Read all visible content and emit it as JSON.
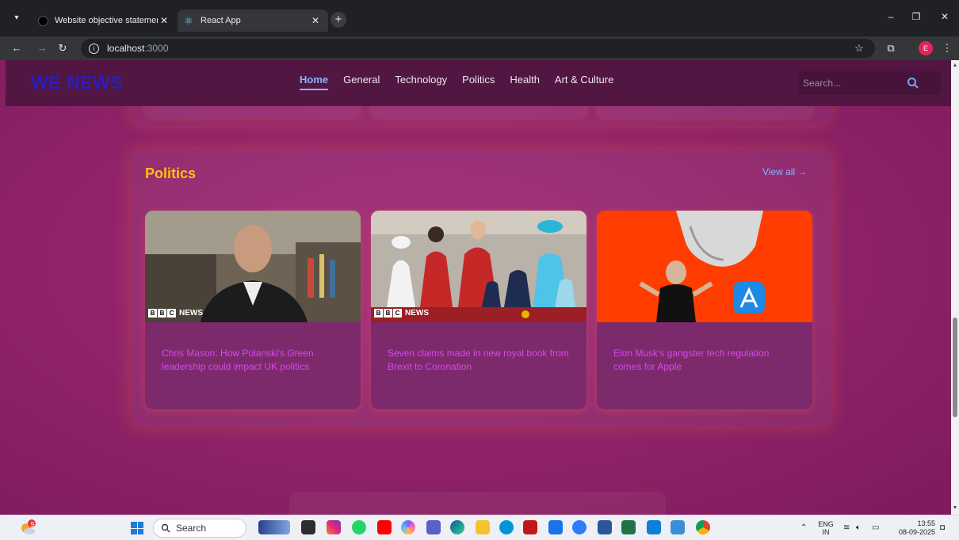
{
  "browser": {
    "tabs": [
      {
        "title": "Website objective statement",
        "active": false
      },
      {
        "title": "React App",
        "active": true
      }
    ],
    "url_host": "localhost",
    "url_port": ":3000",
    "profile_initial": "E"
  },
  "site": {
    "logo": "WE NEWS",
    "nav": [
      "Home",
      "General",
      "Technology",
      "Politics",
      "Health",
      "Art & Culture"
    ],
    "active_nav": "Home",
    "search_placeholder": "Search..."
  },
  "section": {
    "title": "Politics",
    "view_all": "View all →",
    "articles": [
      {
        "headline": "Chris Mason: How Polanski's Green leadership could impact UK politics",
        "source_badge": "NEWS"
      },
      {
        "headline": "Seven claims made in new royal book from Brexit to Coronation",
        "source_badge": "NEWS"
      },
      {
        "headline": "Elon Musk's gangster tech regulation comes for Apple",
        "source_badge": ""
      }
    ]
  },
  "taskbar": {
    "search_label": "Search",
    "notification_count": "9",
    "lang_top": "ENG",
    "lang_bottom": "IN",
    "time": "13:55",
    "date": "08-09-2025"
  },
  "colors": {
    "accent_yellow": "#ffc107",
    "link_blue": "#8ab4ff",
    "headline_magenta": "#d946ef",
    "page_bg": "#8e2268",
    "nav_bg": "#521642"
  }
}
